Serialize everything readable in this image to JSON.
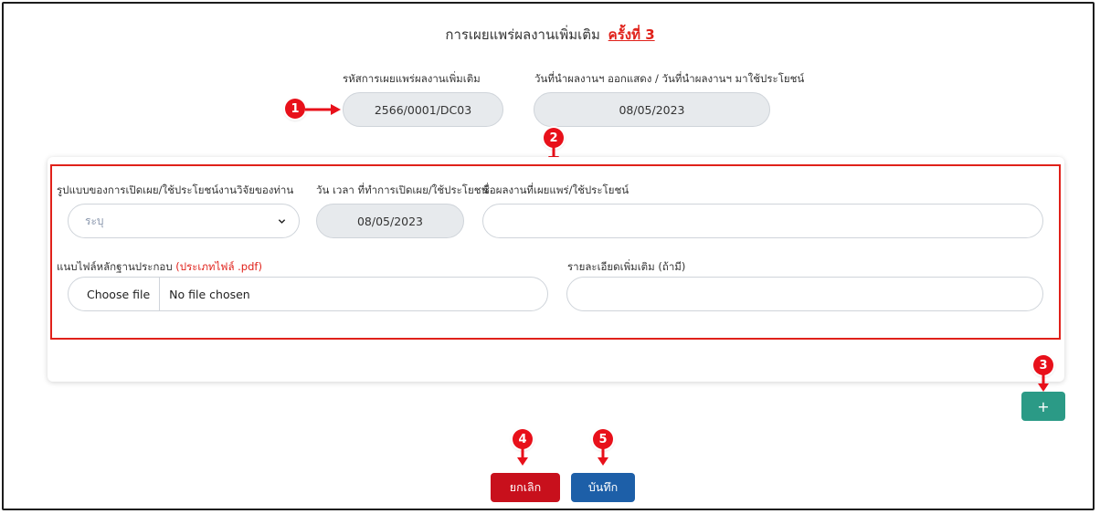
{
  "header": {
    "title": "การเผยแพร่ผลงานเพิ่มเติม",
    "round_label": "ครั้งที่ 3"
  },
  "top_fields": {
    "code_label": "รหัสการเผยแพร่ผลงานเพิ่มเติม",
    "code_value": "2566/0001/DC03",
    "date_label": "วันที่นำผลงานฯ ออกแสดง / วันที่นำผลงานฯ มาใช้ประโยชน์",
    "date_value": "08/05/2023"
  },
  "form": {
    "format_label": "รูปแบบของการเปิดเผย/ใช้ประโยชน์งานวิจัยของท่าน",
    "format_value": "ระบุ",
    "datetime_label": "วัน เวลา ที่ทำการเปิดเผย/ใช้ประโยชน์",
    "datetime_value": "08/05/2023",
    "work_name_label": "ชื่อผลงานที่เผยแพร่/ใช้ประโยชน์",
    "work_name_value": "",
    "attach_label": "แนบไฟล์หลักฐานประกอบ",
    "attach_type_note": "(ประเภทไฟล์ .pdf)",
    "choose_file": "Choose file",
    "no_file": "No file chosen",
    "details_label": "รายละเอียดเพิ่มเติม (ถ้ามี)",
    "details_value": ""
  },
  "buttons": {
    "add": "+",
    "cancel": "ยกเลิก",
    "save": "บันทึก"
  },
  "callouts": [
    "1",
    "2",
    "3",
    "4",
    "5"
  ],
  "colors": {
    "accent_red": "#e0211a",
    "cancel": "#c8101c",
    "save": "#1d5fa8",
    "add": "#2b9a86"
  }
}
